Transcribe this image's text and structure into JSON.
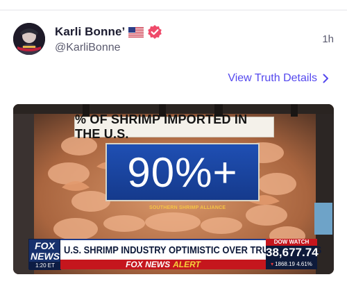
{
  "post": {
    "author": {
      "display_name": "Karli Bonne’",
      "handle": "@KarliBonne",
      "flag_icon": "us-flag-icon",
      "verified_icon": "verified-badge-icon"
    },
    "time_ago": "1h",
    "details_link": {
      "label": "View Truth Details",
      "icon": "chevron-right-icon"
    }
  },
  "media": {
    "headline": "% OF SHRIMP IMPORTED IN THE U.S.",
    "stat_value": "90%+",
    "source": "SOUTHERN SHRIMP ALLIANCE",
    "chyron": {
      "network_top": "FOX",
      "network_bottom": "NEWS",
      "clock": "1:20 ET",
      "headline": "U.S. SHRIMP INDUSTRY OPTIMISTIC OVER TRUMP TARIFFS",
      "alert_brand": "FOX NEWS",
      "alert_word": "ALERT",
      "ticker_label": "DOW WATCH",
      "ticker_value": "38,677.74",
      "ticker_change": "1868.19",
      "ticker_percent": "4.61%"
    }
  },
  "colors": {
    "link": "#5448ee",
    "verified": "#ef4a6a",
    "stat_blue": "#1f4fb3",
    "alert_red": "#c5161d",
    "alert_yellow": "#f6d23a"
  }
}
